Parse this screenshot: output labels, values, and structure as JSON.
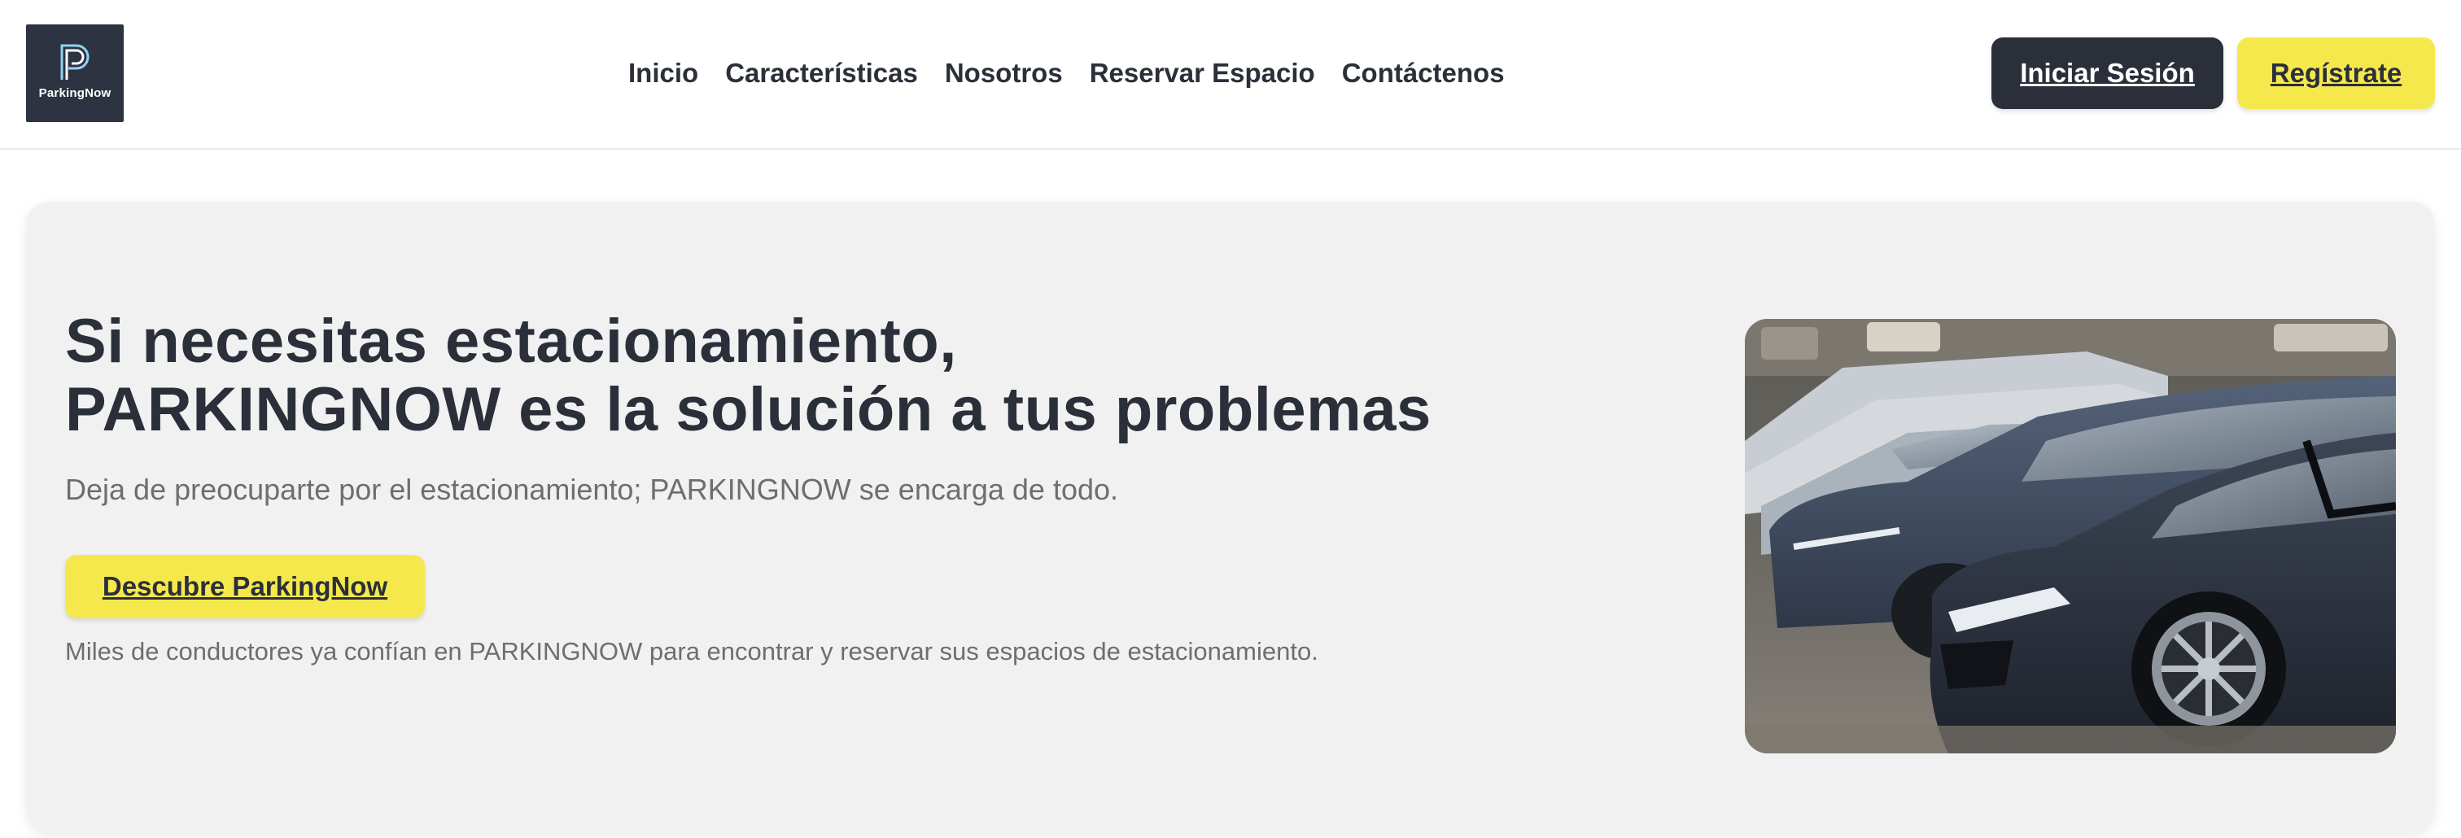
{
  "header": {
    "logo_text": "ParkingNow",
    "nav": [
      "Inicio",
      "Características",
      "Nosotros",
      "Reservar Espacio",
      "Contáctenos"
    ],
    "login_label": "Iniciar Sesión",
    "register_label": "Regístrate"
  },
  "hero": {
    "title_line1": "Si necesitas estacionamiento,",
    "title_line2": "PARKINGNOW es la solución a tus problemas",
    "subtitle": "Deja de preocuparte por el estacionamiento; PARKINGNOW se encarga de todo.",
    "cta_label": "Descubre ParkingNow",
    "note": "Miles de conductores ya confían en PARKINGNOW para encontrar y reservar sus espacios de estacionamiento."
  },
  "colors": {
    "dark": "#2b2f3a",
    "accent": "#f5e84c",
    "hero_bg": "#f1f1f1",
    "muted_text": "#6e6e6e"
  }
}
